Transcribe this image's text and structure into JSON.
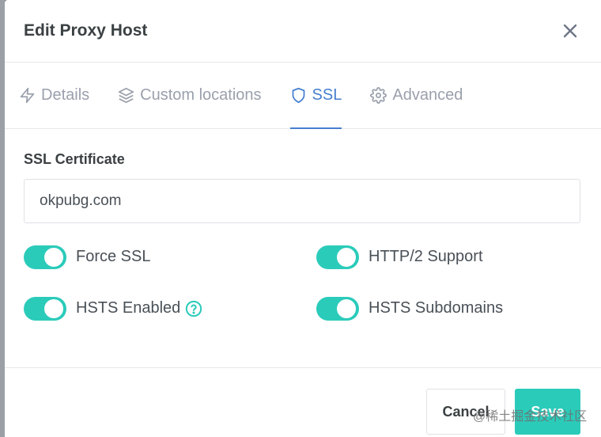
{
  "modal": {
    "title": "Edit Proxy Host",
    "close_icon": "close-icon"
  },
  "tabs": [
    {
      "label": "Details",
      "icon": "lightning-icon",
      "active": false
    },
    {
      "label": "Custom locations",
      "icon": "layers-icon",
      "active": false
    },
    {
      "label": "SSL",
      "icon": "shield-icon",
      "active": true
    },
    {
      "label": "Advanced",
      "icon": "gear-icon",
      "active": false
    }
  ],
  "ssl": {
    "certificate_label": "SSL Certificate",
    "certificate_value": "okpubg.com",
    "toggles": [
      {
        "label": "Force SSL",
        "on": true
      },
      {
        "label": "HTTP/2 Support",
        "on": true
      },
      {
        "label": "HSTS Enabled",
        "on": true,
        "help_icon": "question-circle-icon"
      },
      {
        "label": "HSTS Subdomains",
        "on": true
      }
    ]
  },
  "footer": {
    "cancel_label": "Cancel",
    "save_label": "Save"
  },
  "watermark": "@稀土掘金技术社区",
  "colors": {
    "accent": "#467fcf",
    "toggle_on": "#2bcbba",
    "save_button": "#2bcbba"
  }
}
